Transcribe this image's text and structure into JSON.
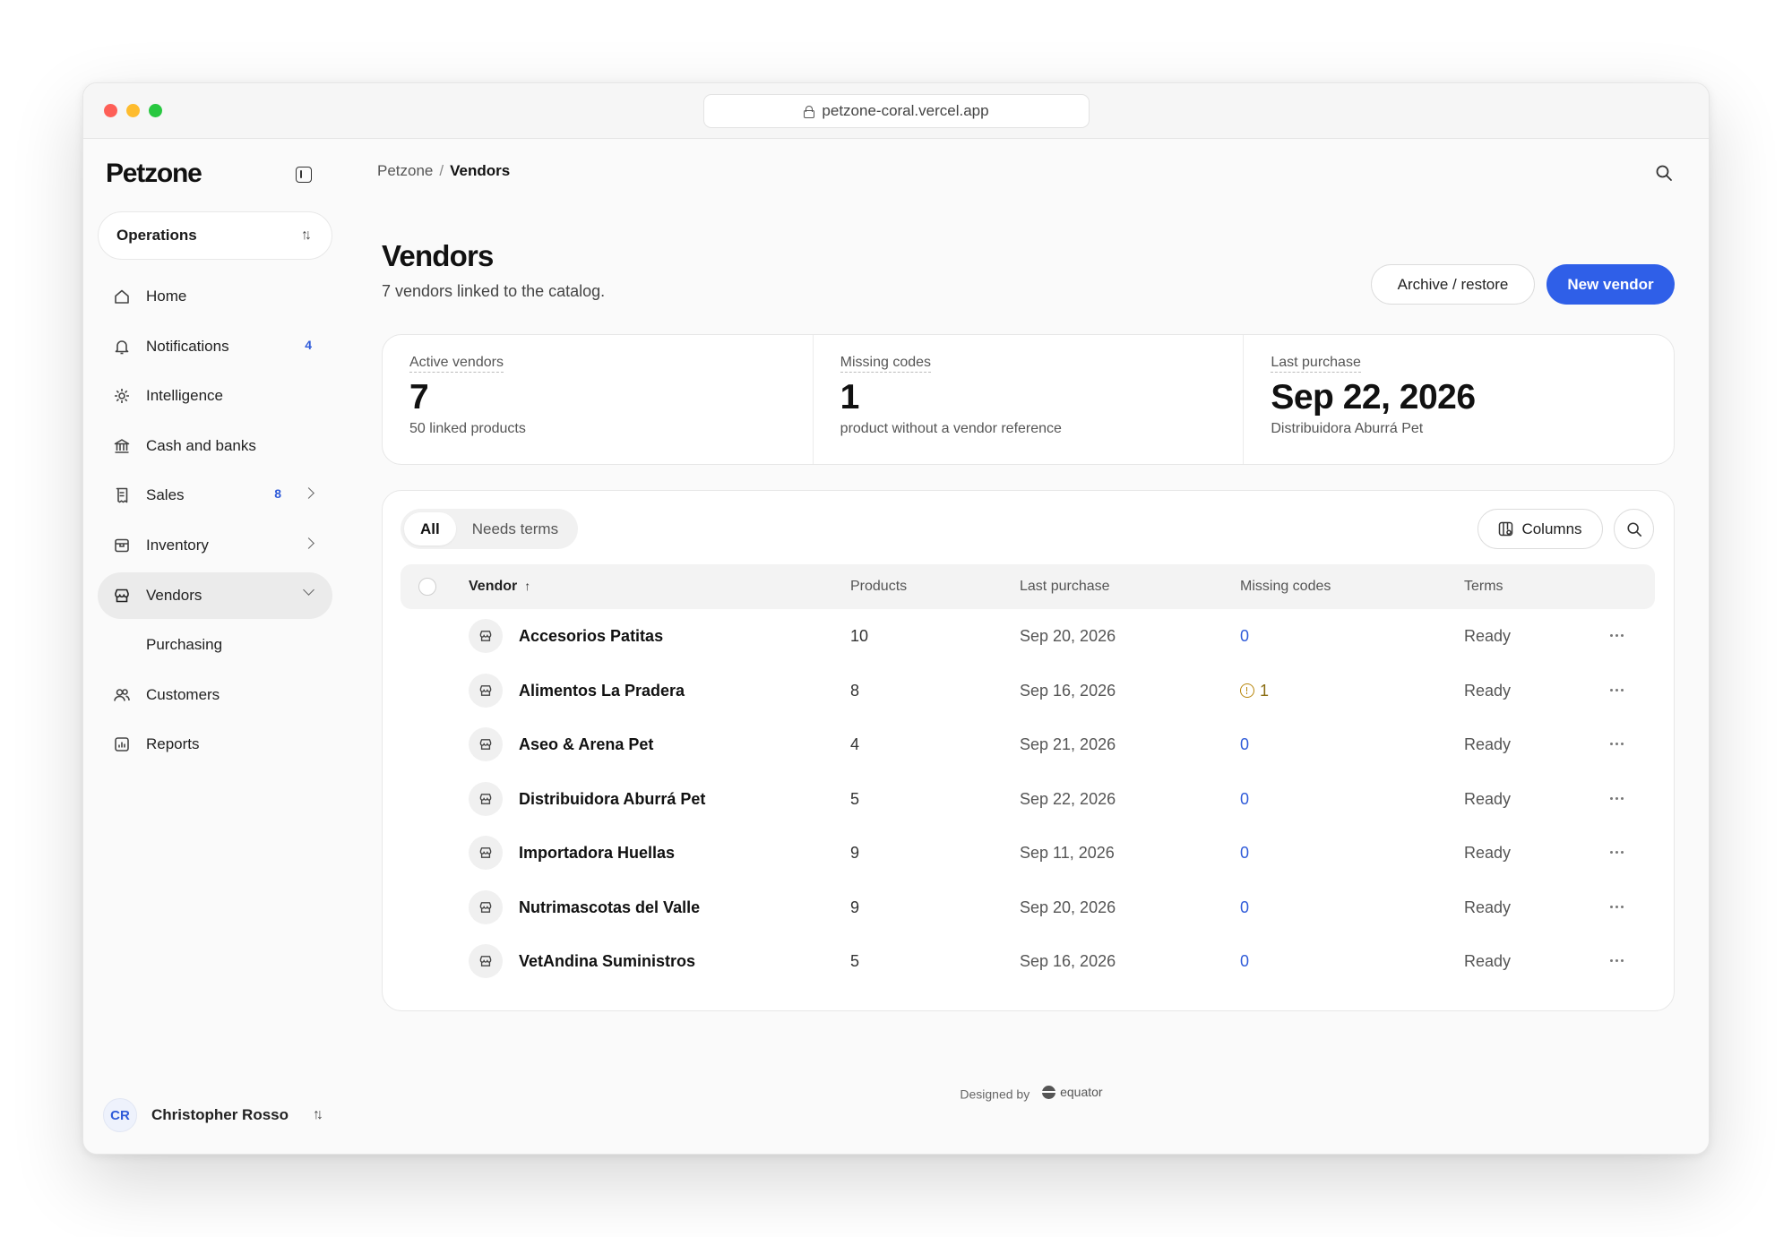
{
  "browser": {
    "url": "petzone-coral.vercel.app"
  },
  "sidebar": {
    "logo": "Petzone",
    "workspace": "Operations",
    "items": [
      {
        "label": "Home",
        "icon": "home-icon"
      },
      {
        "label": "Notifications",
        "icon": "bell-icon",
        "badge": "4"
      },
      {
        "label": "Intelligence",
        "icon": "gear-icon"
      },
      {
        "label": "Cash and banks",
        "icon": "bank-icon"
      },
      {
        "label": "Sales",
        "icon": "receipt-icon",
        "badge": "8"
      },
      {
        "label": "Inventory",
        "icon": "box-icon"
      },
      {
        "label": "Vendors",
        "icon": "store-icon",
        "active": true
      },
      {
        "label": "Purchasing"
      },
      {
        "label": "Customers",
        "icon": "users-icon"
      },
      {
        "label": "Reports",
        "icon": "chart-icon"
      }
    ],
    "user": {
      "initials": "CR",
      "name": "Christopher Rosso"
    }
  },
  "header": {
    "breadcrumb": {
      "root": "Petzone",
      "separator": "/",
      "current": "Vendors"
    }
  },
  "page": {
    "title": "Vendors",
    "subtitle": "7 vendors linked to the catalog.",
    "archive_label": "Archive / restore",
    "new_label": "New vendor"
  },
  "stats": [
    {
      "label": "Active vendors",
      "value": "7",
      "note": "50 linked products"
    },
    {
      "label": "Missing codes",
      "value": "1",
      "note": "product without a vendor reference"
    },
    {
      "label": "Last purchase",
      "value": "Sep 22, 2026",
      "note": "Distribuidora Aburrá Pet"
    }
  ],
  "table": {
    "tabs": [
      "All",
      "Needs terms"
    ],
    "columns_label": "Columns",
    "headers": {
      "vendor": "Vendor",
      "products": "Products",
      "last_purchase": "Last purchase",
      "missing_codes": "Missing codes",
      "terms": "Terms"
    },
    "rows": [
      {
        "vendor": "Accesorios Patitas",
        "products": "10",
        "last_purchase": "Sep 20, 2026",
        "missing": "0",
        "terms": "Ready"
      },
      {
        "vendor": "Alimentos La Pradera",
        "products": "8",
        "last_purchase": "Sep 16, 2026",
        "missing": "1",
        "terms": "Ready",
        "warn": true
      },
      {
        "vendor": "Aseo & Arena Pet",
        "products": "4",
        "last_purchase": "Sep 21, 2026",
        "missing": "0",
        "terms": "Ready"
      },
      {
        "vendor": "Distribuidora Aburrá Pet",
        "products": "5",
        "last_purchase": "Sep 22, 2026",
        "missing": "0",
        "terms": "Ready"
      },
      {
        "vendor": "Importadora Huellas",
        "products": "9",
        "last_purchase": "Sep 11, 2026",
        "missing": "0",
        "terms": "Ready"
      },
      {
        "vendor": "Nutrimascotas del Valle",
        "products": "9",
        "last_purchase": "Sep 20, 2026",
        "missing": "0",
        "terms": "Ready"
      },
      {
        "vendor": "VetAndina Suministros",
        "products": "5",
        "last_purchase": "Sep 16, 2026",
        "missing": "0",
        "terms": "Ready"
      }
    ]
  },
  "footer": {
    "text": "Designed by",
    "brand": "equator"
  },
  "colors": {
    "accent": "#2f5fe8",
    "badge": "#2f5bd9",
    "warning": "#b8860b"
  }
}
